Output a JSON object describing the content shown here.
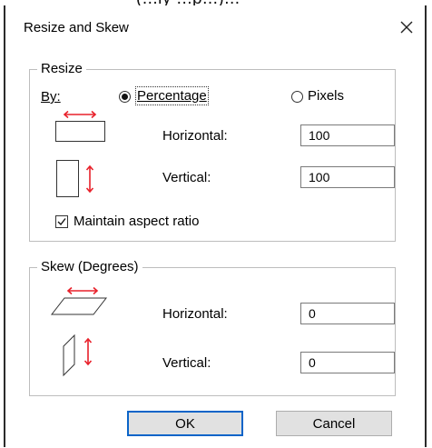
{
  "window": {
    "title": "Resize and Skew"
  },
  "top_strip_text": "(...ly ...p...)...",
  "resize": {
    "legend": "Resize",
    "by_label": "By:",
    "by_mnemonic": "B",
    "options": [
      {
        "label": "Percentage",
        "selected": true
      },
      {
        "label": "Pixels",
        "selected": false
      }
    ],
    "horizontal_label": "Horizontal:",
    "horizontal_value": "100",
    "vertical_label": "Vertical:",
    "vertical_value": "100",
    "maintain_label": "Maintain aspect ratio",
    "maintain_checked": true
  },
  "skew": {
    "legend": "Skew (Degrees)",
    "horizontal_label": "Horizontal:",
    "horizontal_value": "0",
    "vertical_label": "Vertical:",
    "vertical_value": "0"
  },
  "buttons": {
    "ok_label": "OK",
    "cancel_label": "Cancel"
  },
  "colors": {
    "arrow_red": "#e8202a",
    "default_button_border": "#0a64c8"
  },
  "icons": {
    "close": "close-icon",
    "resize_horizontal": "resize-horizontal-icon",
    "resize_vertical": "resize-vertical-icon",
    "skew_horizontal": "skew-horizontal-icon",
    "skew_vertical": "skew-vertical-icon"
  }
}
